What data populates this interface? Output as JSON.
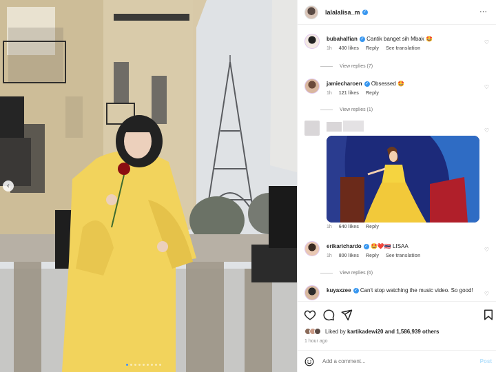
{
  "post": {
    "username": "lalalalisa_m",
    "more_label": "···",
    "carousel_dots": 9,
    "carousel_active": 0,
    "prev_arrow": "‹"
  },
  "comments": [
    {
      "username": "bubahalfian",
      "text": "Cantik banget sih Mbak 🤩",
      "time": "1h",
      "likes": "400 likes",
      "reply": "Reply",
      "translate": "See translation",
      "view_replies": "View replies (7)"
    },
    {
      "username": "jamiecharoen",
      "text": "Obsessed 🤩",
      "time": "1h",
      "likes": "121 likes",
      "reply": "Reply",
      "view_replies": "View replies (1)"
    },
    {
      "username": "",
      "text": "",
      "time": "1h",
      "likes": "640 likes",
      "reply": "Reply"
    },
    {
      "username": "erikarichardo",
      "text": "🤩❤️🇹🇭 LISAA",
      "time": "1h",
      "likes": "800 likes",
      "reply": "Reply",
      "translate": "See translation",
      "view_replies": "View replies (6)"
    },
    {
      "username": "kuyaxzee",
      "text": "Can't stop watching the music video. So good!"
    }
  ],
  "actions": {
    "liked_by_prefix": "Liked by",
    "liked_by_user": "kartikadewi20",
    "liked_by_suffix": "and 1,586,939 others",
    "time_ago": "1 hour ago"
  },
  "add_comment": {
    "placeholder": "Add a comment...",
    "post_label": "Post"
  },
  "colors": {
    "verified": "#3897f0",
    "coat": "#f2d35c",
    "link_blue": "#0095f6"
  }
}
